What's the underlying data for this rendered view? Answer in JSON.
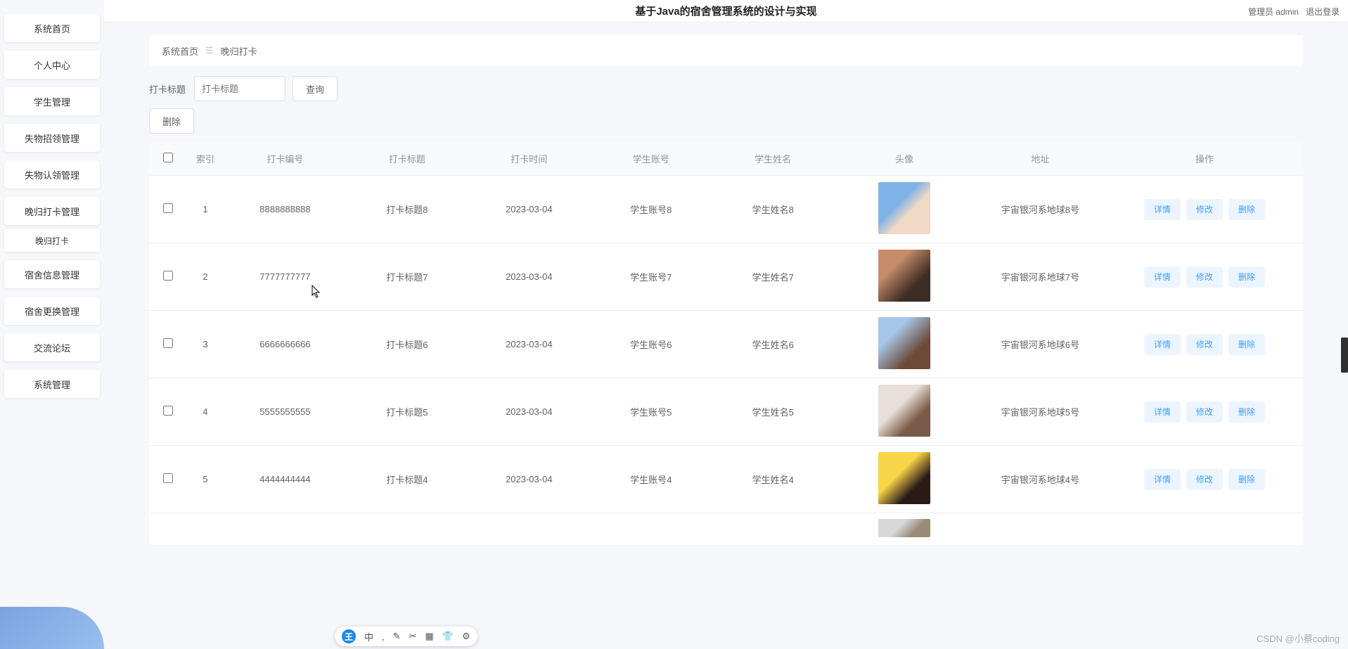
{
  "header": {
    "title": "基于Java的宿舍管理系统的设计与实现",
    "user_label": "管理员 admin",
    "logout": "退出登录"
  },
  "sidebar": {
    "items": [
      {
        "label": "系统首页",
        "name": "home"
      },
      {
        "label": "个人中心",
        "name": "profile"
      },
      {
        "label": "学生管理",
        "name": "students"
      },
      {
        "label": "失物招领管理",
        "name": "lost-found"
      },
      {
        "label": "失物认领管理",
        "name": "claim"
      },
      {
        "label": "晚归打卡管理",
        "name": "checkin-mgmt"
      },
      {
        "label": "宿舍信息管理",
        "name": "dorm-info"
      },
      {
        "label": "宿舍更换管理",
        "name": "dorm-change"
      },
      {
        "label": "交流论坛",
        "name": "forum"
      },
      {
        "label": "系统管理",
        "name": "system"
      }
    ],
    "subitem": {
      "label": "晚归打卡",
      "name": "checkin"
    }
  },
  "breadcrumb": {
    "home": "系统首页",
    "current": "晚归打卡"
  },
  "toolbar": {
    "search_label": "打卡标题",
    "search_placeholder": "打卡标题",
    "query": "查询",
    "delete": "删除"
  },
  "table": {
    "headers": {
      "index": "索引",
      "code": "打卡编号",
      "title": "打卡标题",
      "time": "打卡时间",
      "account": "学生账号",
      "name": "学生姓名",
      "avatar": "头像",
      "address": "地址",
      "ops": "操作"
    },
    "ops": {
      "detail": "详情",
      "edit": "修改",
      "delete": "删除"
    },
    "rows": [
      {
        "idx": "1",
        "code": "8888888888",
        "title": "打卡标题8",
        "time": "2023-03-04",
        "account": "学生账号8",
        "name": "学生姓名8",
        "address": "宇宙银河系地球8号",
        "av": "av1"
      },
      {
        "idx": "2",
        "code": "7777777777",
        "title": "打卡标题7",
        "time": "2023-03-04",
        "account": "学生账号7",
        "name": "学生姓名7",
        "address": "宇宙银河系地球7号",
        "av": "av2"
      },
      {
        "idx": "3",
        "code": "6666666666",
        "title": "打卡标题6",
        "time": "2023-03-04",
        "account": "学生账号6",
        "name": "学生姓名6",
        "address": "宇宙银河系地球6号",
        "av": "av3"
      },
      {
        "idx": "4",
        "code": "5555555555",
        "title": "打卡标题5",
        "time": "2023-03-04",
        "account": "学生账号5",
        "name": "学生姓名5",
        "address": "宇宙银河系地球5号",
        "av": "av4"
      },
      {
        "idx": "5",
        "code": "4444444444",
        "title": "打卡标题4",
        "time": "2023-03-04",
        "account": "学生账号4",
        "name": "学生姓名4",
        "address": "宇宙银河系地球4号",
        "av": "av5"
      }
    ]
  },
  "watermark": "CSDN @小蔡coding",
  "ime": {
    "logo": "王",
    "icons": [
      "中",
      ",",
      "✎",
      "✂",
      "▦",
      "👕",
      "⚙"
    ]
  }
}
